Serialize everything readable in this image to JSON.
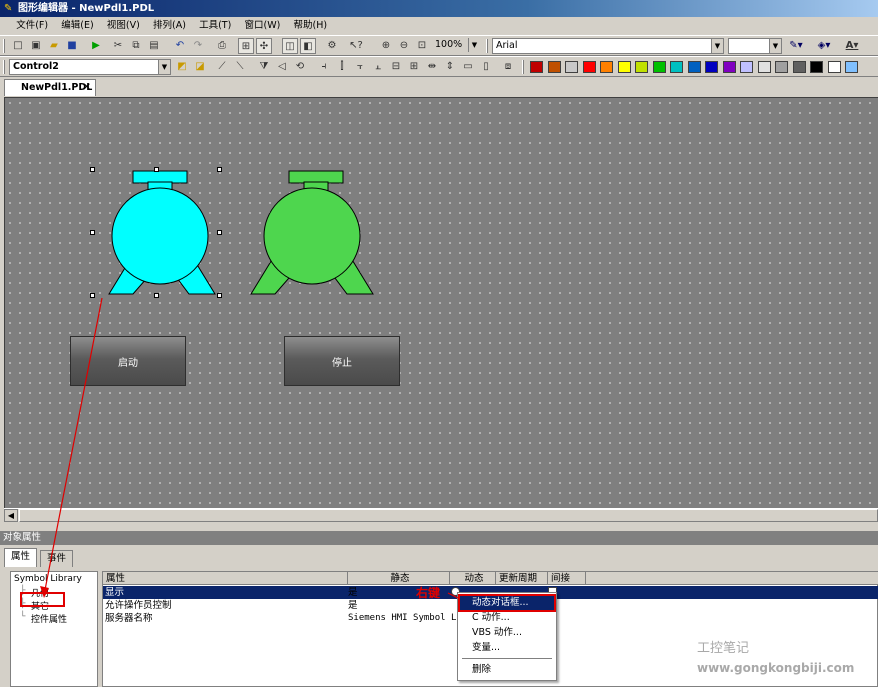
{
  "window": {
    "title": "图形编辑器 - NewPdl1.PDL"
  },
  "menu": [
    "文件(F)",
    "编辑(E)",
    "视图(V)",
    "排列(A)",
    "工具(T)",
    "窗口(W)",
    "帮助(H)"
  ],
  "toolbar": {
    "zoom": "100%",
    "font": "Arial",
    "object_selector": "Control2",
    "palette": [
      "#c00000",
      "#c05000",
      "#c8c8c8",
      "#ff0000",
      "#ff8000",
      "#ffff00",
      "#c0e000",
      "#00c000",
      "#00c0c0",
      "#0060c0",
      "#0000c0",
      "#8000c0",
      "#c0c0ff",
      "#e0e0e0",
      "#a0a0a0",
      "#606060",
      "#000000",
      "#ffffff",
      "#80c0ff"
    ]
  },
  "document": {
    "tab_label": "NewPdl1.PDL"
  },
  "canvas": {
    "pump1_color": "#00ffff",
    "pump2_color": "#4ed64e",
    "start_button": "启动",
    "stop_button": "停止"
  },
  "properties_panel": {
    "title": "对象属性",
    "tabs": [
      "属性",
      "事件"
    ],
    "tree": [
      "Symbol Library",
      "几何",
      "其它",
      "控件属性"
    ],
    "columns": [
      "属性",
      "静态",
      "动态",
      "更新周期",
      "间接"
    ],
    "rows": [
      {
        "name": "显示",
        "static": "是"
      },
      {
        "name": "允许操作员控制",
        "static": "是"
      },
      {
        "name": "服务器名称",
        "static": "Siemens HMI Symbol L"
      }
    ]
  },
  "context_menu": {
    "items": [
      "动态对话框...",
      "C 动作...",
      "VBS 动作...",
      "变量...",
      "删除"
    ]
  },
  "annotation": {
    "label": "右键"
  },
  "watermark": {
    "line1": "工控笔记",
    "line2": "www.gongkongbiji.com"
  }
}
